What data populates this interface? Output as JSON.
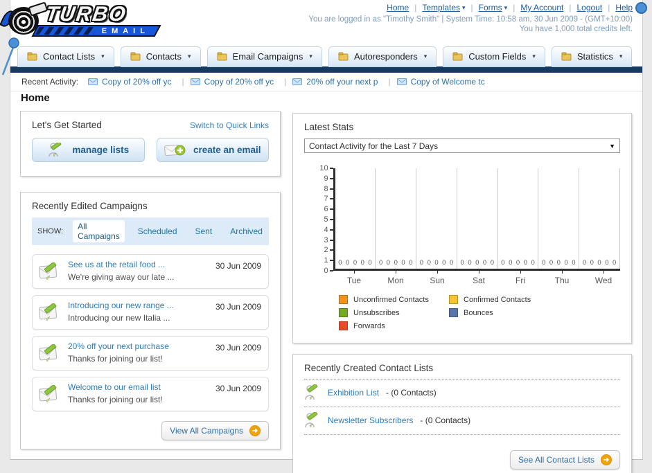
{
  "brand": {
    "name_top": "TURBO",
    "name_bottom": "EMAIL"
  },
  "header": {
    "nav_links": [
      {
        "label": "Home",
        "dropdown": false
      },
      {
        "label": "Templates",
        "dropdown": true
      },
      {
        "label": "Forms",
        "dropdown": true
      },
      {
        "label": "My Account",
        "dropdown": false
      },
      {
        "label": "Logout",
        "dropdown": false
      },
      {
        "label": "Help",
        "dropdown": false
      }
    ],
    "login_line": "You are logged in as \"Timothy Smith\" | System Time: 10:58 am, 30 Jun 2009 - (GMT+10:00)",
    "credits_line": "You have 1,000 total credits left."
  },
  "tabs": [
    {
      "label": "Contact Lists",
      "icon": "folder-icon"
    },
    {
      "label": "Contacts",
      "icon": "contacts-icon"
    },
    {
      "label": "Email Campaigns",
      "icon": "envelope-icon"
    },
    {
      "label": "Autoresponders",
      "icon": "autoresponder-icon"
    },
    {
      "label": "Custom Fields",
      "icon": "pages-icon"
    },
    {
      "label": "Statistics",
      "icon": "bar-chart-icon"
    }
  ],
  "recent_activity": {
    "label": "Recent Activity:",
    "items": [
      "Copy of 20% off yc",
      "Copy of 20% off yc",
      "20% off your next p",
      "Copy of Welcome tc"
    ]
  },
  "page_title": "Home",
  "get_started": {
    "title": "Let's Get Started",
    "switch_link": "Switch to Quick Links",
    "manage_lists_label": "manage lists",
    "create_email_label": "create an email"
  },
  "campaigns": {
    "title": "Recently Edited Campaigns",
    "show_label": "SHOW:",
    "filters": [
      {
        "label": "All Campaigns",
        "selected": true
      },
      {
        "label": "Scheduled",
        "selected": false
      },
      {
        "label": "Sent",
        "selected": false
      },
      {
        "label": "Archived",
        "selected": false
      }
    ],
    "items": [
      {
        "title": "See us at the retail food ...",
        "subtitle": "We're giving away our late ...",
        "date": "30 Jun 2009"
      },
      {
        "title": "Introducing our new range ...",
        "subtitle": "Introducing our new Italia ...",
        "date": "30 Jun 2009"
      },
      {
        "title": "20% off your next purchase",
        "subtitle": "Thanks for joining our list!",
        "date": "30 Jun 2009"
      },
      {
        "title": "Welcome to our email list",
        "subtitle": "Thanks for joining our list!",
        "date": "30 Jun 2009"
      }
    ],
    "view_all_label": "View All Campaigns"
  },
  "stats": {
    "title": "Latest Stats",
    "selected_option": "Contact Activity for the Last 7 Days"
  },
  "chart_data": {
    "type": "bar",
    "title": "Contact Activity for the Last 7 Days",
    "categories": [
      "Tue",
      "Mon",
      "Sun",
      "Sat",
      "Fri",
      "Thu",
      "Wed"
    ],
    "series": [
      {
        "name": "Unconfirmed Contacts",
        "color": "#f5941d",
        "values": [
          0,
          0,
          0,
          0,
          0,
          0,
          0
        ]
      },
      {
        "name": "Confirmed Contacts",
        "color": "#f9c52f",
        "values": [
          0,
          0,
          0,
          0,
          0,
          0,
          0
        ]
      },
      {
        "name": "Unsubscribes",
        "color": "#74aa20",
        "values": [
          0,
          0,
          0,
          0,
          0,
          0,
          0
        ]
      },
      {
        "name": "Bounces",
        "color": "#5876ab",
        "values": [
          0,
          0,
          0,
          0,
          0,
          0,
          0
        ]
      },
      {
        "name": "Forwards",
        "color": "#e84d29",
        "values": [
          0,
          0,
          0,
          0,
          0,
          0,
          0
        ]
      }
    ],
    "xlabel": "",
    "ylabel": "",
    "ylim": [
      0,
      10
    ],
    "ytick_step": 1,
    "grid": "vertical",
    "legend_position": "bottom"
  },
  "contact_lists": {
    "title": "Recently Created Contact Lists",
    "items": [
      {
        "name": "Exhibition List",
        "count": "- (0 Contacts)"
      },
      {
        "name": "Newsletter Subscribers",
        "count": "- (0 Contacts)"
      }
    ],
    "see_all_label": "See All Contact Lists"
  },
  "colors": {
    "navy_bar": "#163a60",
    "brand_blue": "#1756d8",
    "link_blue": "#2e7cb8",
    "orange_button": "#f0a30a"
  }
}
